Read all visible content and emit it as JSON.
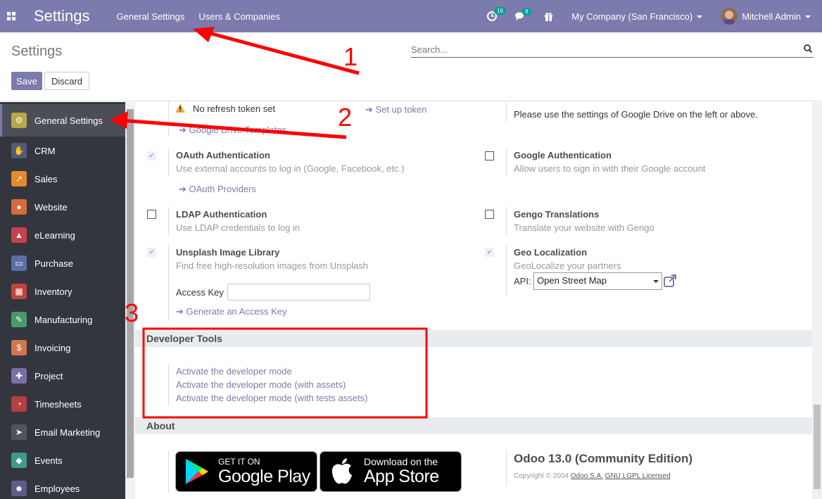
{
  "navbar": {
    "app_title": "Settings",
    "menu": [
      "General Settings",
      "Users & Companies"
    ],
    "activity_count": "16",
    "messages_count": "8",
    "company": "My Company (San Francisco)",
    "user": "Mitchell Admin"
  },
  "control_panel": {
    "title": "Settings",
    "search_placeholder": "Search...",
    "save_label": "Save",
    "discard_label": "Discard"
  },
  "sidebar": {
    "items": [
      {
        "label": "General Settings",
        "color": "#b8a84a"
      },
      {
        "label": "CRM",
        "color": "#4f5b78"
      },
      {
        "label": "Sales",
        "color": "#e58a2e"
      },
      {
        "label": "Website",
        "color": "#d36b3a"
      },
      {
        "label": "eLearning",
        "color": "#c8424b"
      },
      {
        "label": "Purchase",
        "color": "#5a6fa6"
      },
      {
        "label": "Inventory",
        "color": "#c0453d"
      },
      {
        "label": "Manufacturing",
        "color": "#4a9a6c"
      },
      {
        "label": "Invoicing",
        "color": "#d1764f"
      },
      {
        "label": "Project",
        "color": "#7b6fa8"
      },
      {
        "label": "Timesheets",
        "color": "#b5403f"
      },
      {
        "label": "Email Marketing",
        "color": "#4f5560"
      },
      {
        "label": "Events",
        "color": "#3c9b8b"
      },
      {
        "label": "Employees",
        "color": "#5e5c8a"
      }
    ]
  },
  "content": {
    "google_drive": {
      "no_token": "No refresh token set",
      "setup_token": "Set up token",
      "templates_link": "Google Drive Templates",
      "right_note": "Please use the settings of Google Drive on the left or above."
    },
    "oauth": {
      "title": "OAuth Authentication",
      "desc": "Use external accounts to log in (Google, Facebook, etc.)",
      "link": "OAuth Providers",
      "checked": true
    },
    "google_auth": {
      "title": "Google Authentication",
      "desc": "Allow users to sign in with their Google account",
      "checked": false
    },
    "ldap": {
      "title": "LDAP Authentication",
      "desc": "Use LDAP credentials to log in",
      "checked": false
    },
    "gengo": {
      "title": "Gengo Translations",
      "desc": "Translate your website with Gengo",
      "checked": false
    },
    "unsplash": {
      "title": "Unsplash Image Library",
      "desc": "Find free high-resolution images from Unsplash",
      "access_key_label": "Access Key",
      "access_key_value": "",
      "generate_link": "Generate an Access Key",
      "checked": true
    },
    "geo": {
      "title": "Geo Localization",
      "desc": "GeoLocalize your partners",
      "api_label": "API:",
      "api_value": "Open Street Map",
      "checked": true
    },
    "developer_tools": {
      "heading": "Developer Tools",
      "links": [
        "Activate the developer mode",
        "Activate the developer mode (with assets)",
        "Activate the developer mode (with tests assets)"
      ]
    },
    "about": {
      "heading": "About",
      "google_play_top": "GET IT ON",
      "google_play_bottom": "Google Play",
      "app_store_top": "Download on the",
      "app_store_bottom": "App Store",
      "version": "Odoo 13.0 (Community Edition)",
      "copyright_prefix": "Copyright © 2004",
      "company_link": "Odoo S.A.",
      "license_link": "GNU LGPL Licensed"
    }
  },
  "annotations": {
    "labels": [
      "1",
      "2",
      "3"
    ],
    "color": "#ff0000"
  }
}
